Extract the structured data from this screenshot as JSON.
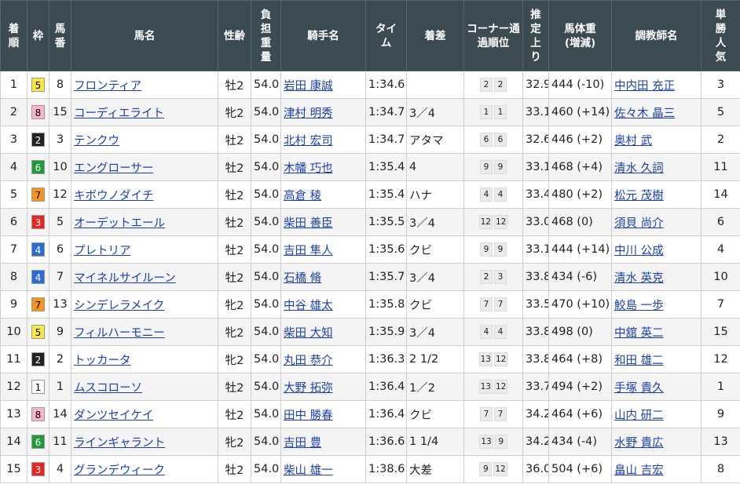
{
  "headers": {
    "rank": "着順",
    "waku": "枠",
    "horse_no": "馬番",
    "horse": "馬名",
    "sex_age": "性齢",
    "weight_carried": "負担重量",
    "jockey": "騎手名",
    "time": "タイム",
    "margin": "着差",
    "corner": "コーナー通過順位",
    "last3f": "推定上り",
    "body_weight": "馬体重(増減)",
    "trainer": "調教師名",
    "popularity": "単勝人気"
  },
  "waku_colors": {
    "1": {
      "bg": "#ffffff",
      "fg": "#000000"
    },
    "2": {
      "bg": "#222222",
      "fg": "#ffffff"
    },
    "3": {
      "bg": "#e8251f",
      "fg": "#ffffff"
    },
    "4": {
      "bg": "#2a6bd8",
      "fg": "#ffffff"
    },
    "5": {
      "bg": "#ffe83d",
      "fg": "#000000"
    },
    "6": {
      "bg": "#1f9a3b",
      "fg": "#ffffff"
    },
    "7": {
      "bg": "#f7941d",
      "fg": "#000000"
    },
    "8": {
      "bg": "#f9b6c8",
      "fg": "#000000"
    }
  },
  "rows": [
    {
      "rank": "1",
      "waku": "5",
      "no": "8",
      "horse": "フロンティア",
      "sex": "牡2",
      "wt": "54.0",
      "jockey": "岩田 康誠",
      "time": "1:34.6",
      "margin": "",
      "c1": "2",
      "c2": "2",
      "last": "32.9",
      "bw": "444 (-10)",
      "trainer": "中内田 充正",
      "pop": "3"
    },
    {
      "rank": "2",
      "waku": "8",
      "no": "15",
      "horse": "コーディエライト",
      "sex": "牝2",
      "wt": "54.0",
      "jockey": "津村 明秀",
      "time": "1:34.7",
      "margin": "3／4",
      "c1": "1",
      "c2": "1",
      "last": "33.1",
      "bw": "460 (+14)",
      "trainer": "佐々木 晶三",
      "pop": "5"
    },
    {
      "rank": "3",
      "waku": "2",
      "no": "3",
      "horse": "テンクウ",
      "sex": "牡2",
      "wt": "54.0",
      "jockey": "北村 宏司",
      "time": "1:34.7",
      "margin": "アタマ",
      "c1": "6",
      "c2": "6",
      "last": "32.6",
      "bw": "446 (+2)",
      "trainer": "奥村 武",
      "pop": "2"
    },
    {
      "rank": "4",
      "waku": "6",
      "no": "10",
      "horse": "エングローサー",
      "sex": "牡2",
      "wt": "54.0",
      "jockey": "木幡 巧也",
      "time": "1:35.4",
      "margin": "4",
      "c1": "9",
      "c2": "9",
      "last": "33.1",
      "bw": "468 (+4)",
      "trainer": "清水 久詞",
      "pop": "11"
    },
    {
      "rank": "5",
      "waku": "7",
      "no": "12",
      "horse": "キボウノダイチ",
      "sex": "牡2",
      "wt": "54.0",
      "jockey": "高倉 稜",
      "time": "1:35.4",
      "margin": "ハナ",
      "c1": "4",
      "c2": "4",
      "last": "33.4",
      "bw": "480 (+2)",
      "trainer": "松元 茂樹",
      "pop": "14"
    },
    {
      "rank": "6",
      "waku": "3",
      "no": "5",
      "horse": "オーデットエール",
      "sex": "牡2",
      "wt": "54.0",
      "jockey": "柴田 善臣",
      "time": "1:35.5",
      "margin": "3／4",
      "c1": "12",
      "c2": "12",
      "last": "33.0",
      "bw": "468 (0)",
      "trainer": "須貝 尚介",
      "pop": "6"
    },
    {
      "rank": "7",
      "waku": "4",
      "no": "6",
      "horse": "プレトリア",
      "sex": "牡2",
      "wt": "54.0",
      "jockey": "吉田 隼人",
      "time": "1:35.6",
      "margin": "クビ",
      "c1": "9",
      "c2": "9",
      "last": "33.1",
      "bw": "444 (+14)",
      "trainer": "中川 公成",
      "pop": "4"
    },
    {
      "rank": "8",
      "waku": "4",
      "no": "7",
      "horse": "マイネルサイルーン",
      "sex": "牡2",
      "wt": "54.0",
      "jockey": "石橋 脩",
      "time": "1:35.7",
      "margin": "3／4",
      "c1": "2",
      "c2": "3",
      "last": "33.8",
      "bw": "434 (-6)",
      "trainer": "清水 英克",
      "pop": "10"
    },
    {
      "rank": "9",
      "waku": "7",
      "no": "13",
      "horse": "シンデレラメイク",
      "sex": "牝2",
      "wt": "54.0",
      "jockey": "中谷 雄太",
      "time": "1:35.8",
      "margin": "クビ",
      "c1": "7",
      "c2": "7",
      "last": "33.5",
      "bw": "470 (+10)",
      "trainer": "鮫島 一歩",
      "pop": "7"
    },
    {
      "rank": "10",
      "waku": "5",
      "no": "9",
      "horse": "フィルハーモニー",
      "sex": "牝2",
      "wt": "54.0",
      "jockey": "柴田 大知",
      "time": "1:35.9",
      "margin": "3／4",
      "c1": "4",
      "c2": "4",
      "last": "33.8",
      "bw": "498 (0)",
      "trainer": "中舘 英二",
      "pop": "15"
    },
    {
      "rank": "11",
      "waku": "2",
      "no": "2",
      "horse": "トッカータ",
      "sex": "牝2",
      "wt": "54.0",
      "jockey": "丸田 恭介",
      "time": "1:36.3",
      "margin": "2 1/2",
      "c1": "13",
      "c2": "12",
      "last": "33.8",
      "bw": "464 (+8)",
      "trainer": "和田 雄二",
      "pop": "12"
    },
    {
      "rank": "12",
      "waku": "1",
      "no": "1",
      "horse": "ムスコローソ",
      "sex": "牡2",
      "wt": "54.0",
      "jockey": "大野 拓弥",
      "time": "1:36.4",
      "margin": "1／2",
      "c1": "13",
      "c2": "12",
      "last": "33.7",
      "bw": "494 (+2)",
      "trainer": "手塚 貴久",
      "pop": "1"
    },
    {
      "rank": "13",
      "waku": "8",
      "no": "14",
      "horse": "ダンツセイケイ",
      "sex": "牡2",
      "wt": "54.0",
      "jockey": "田中 勝春",
      "time": "1:36.4",
      "margin": "クビ",
      "c1": "7",
      "c2": "7",
      "last": "34.2",
      "bw": "464 (+6)",
      "trainer": "山内 研二",
      "pop": "9"
    },
    {
      "rank": "14",
      "waku": "6",
      "no": "11",
      "horse": "ラインギャラント",
      "sex": "牝2",
      "wt": "54.0",
      "jockey": "吉田 豊",
      "time": "1:36.6",
      "margin": "1 1/4",
      "c1": "13",
      "c2": "9",
      "last": "34.2",
      "bw": "434 (-4)",
      "trainer": "水野 貴広",
      "pop": "13"
    },
    {
      "rank": "15",
      "waku": "3",
      "no": "4",
      "horse": "グランデウィーク",
      "sex": "牡2",
      "wt": "54.0",
      "jockey": "柴山 雄一",
      "time": "1:38.6",
      "margin": "大差",
      "c1": "9",
      "c2": "12",
      "last": "36.0",
      "bw": "504 (+6)",
      "trainer": "畠山 吉宏",
      "pop": "8"
    }
  ]
}
